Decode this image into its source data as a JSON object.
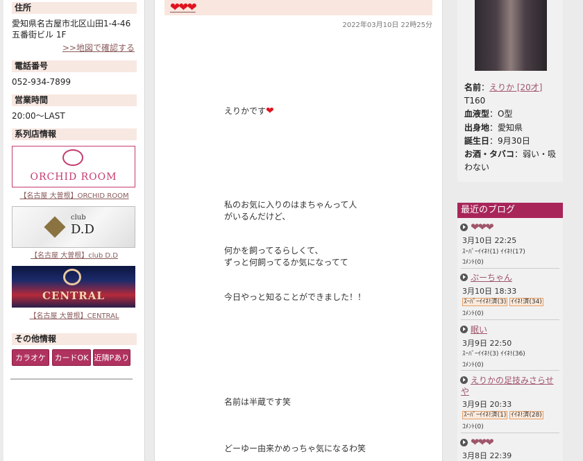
{
  "sidebar": {
    "address_heading": "住所",
    "address_line1": "愛知県名古屋市北区山田1-4-46",
    "address_line2": "五番街ビル 1F",
    "map_link": ">>地図で確認する",
    "phone_heading": "電話番号",
    "phone": "052-934-7899",
    "hours_heading": "営業時間",
    "hours": "20:00〜LAST",
    "affiliates_heading": "系列店情報",
    "affiliates": [
      {
        "banner": "ORCHID ROOM",
        "caption": "【名古屋 大曽根】ORCHID ROOM"
      },
      {
        "banner_small": "club",
        "banner": "D.D",
        "caption": "【名古屋 大曽根】club D.D"
      },
      {
        "banner": "CENTRAL",
        "caption": "【名古屋 大曽根】CENTRAL"
      }
    ],
    "other_heading": "その他情報",
    "tags": [
      "カラオケ",
      "カードOK",
      "近隣Pあり"
    ]
  },
  "post": {
    "title": "❤❤❤",
    "date": "2022年03月10日 22時25分",
    "paragraphs": [
      "えりかです",
      "私のお気に入りのはまちゃんって人",
      "がいるんだけど、",
      "何かを飼ってるらしくて、",
      "ずっと何飼ってるか気になってて",
      "今日やっと知ることができました！！",
      "名前は半蔵です笑",
      "どーゆー由来かめっちゃ気になるわ笑"
    ],
    "heart": "❤"
  },
  "profile": {
    "name_label": "名前",
    "name_value": "えりか [20才]",
    "height": "T160",
    "blood_label": "血液型",
    "blood_value": "O型",
    "birthplace_label": "出身地",
    "birthplace_value": "愛知県",
    "birthday_label": "誕生日",
    "birthday_value": "9月30日",
    "drink_label": "お酒・タバコ",
    "drink_value_1": "弱い・吸",
    "drink_value_2": "わない",
    "separator": "："
  },
  "blog": {
    "heading": "最近のブログ",
    "entries": [
      {
        "title": "❤❤❤",
        "date": "3月10日 22:25",
        "super": "ｽｰﾊﾟｰｲｲﾈ!(1)",
        "iine": "ｲｲﾈ!(17)",
        "comment": "ｺﾒﾝﾄ(0)"
      },
      {
        "title": "ぷーちゃん",
        "date": "3月10日 18:33",
        "super": "ｽｰﾊﾟｰｲｲﾈ!済(3)",
        "iine": "ｲｲﾈ!済(34)",
        "comment": "ｺﾒﾝﾄ(0)"
      },
      {
        "title": "眠い",
        "date": "3月9日 22:50",
        "super": "ｽｰﾊﾟｰｲｲﾈ!(3)",
        "iine": "ｲｲﾈ!(36)",
        "comment": "ｺﾒﾝﾄ(0)"
      },
      {
        "title": "えりかの足技みさらせ",
        "title2": "や",
        "date": "3月9日 20:33",
        "super": "ｽｰﾊﾟｰｲｲﾈ!済(1)",
        "iine": "ｲｲﾈ!済(28)",
        "comment": "ｺﾒﾝﾄ(0)"
      },
      {
        "title": "❤❤❤",
        "date": "3月8日 22:39"
      }
    ]
  }
}
